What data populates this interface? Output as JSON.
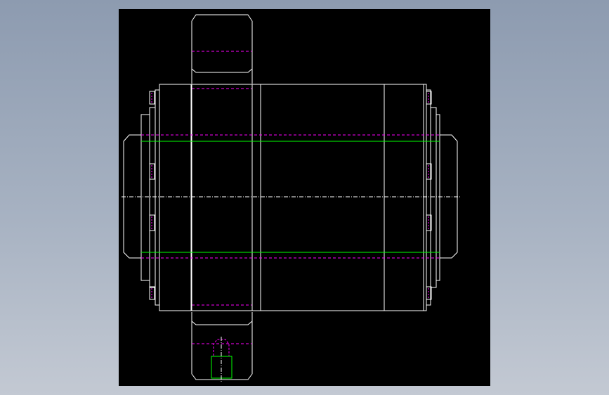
{
  "drawing": {
    "viewport_background": "#000000",
    "page_background": "#9aa6b8",
    "line_colors": {
      "outline": "#ffffff",
      "hidden": "#ff00ff",
      "bore": "#00ff00",
      "centerline": "#ffffff"
    }
  }
}
